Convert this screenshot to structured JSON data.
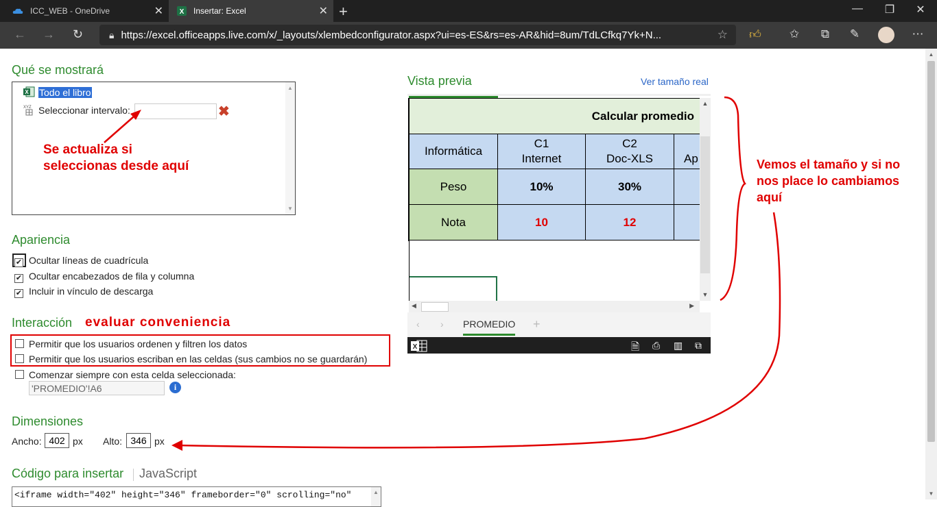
{
  "browser": {
    "tabs": [
      {
        "title": "ICC_WEB - OneDrive"
      },
      {
        "title": "Insertar: Excel"
      }
    ],
    "url": "https://excel.officeapps.live.com/x/_layouts/xlembedconfigurator.aspx?ui=es-ES&rs=es-AR&hid=8um/TdLCfkq7Yk+N..."
  },
  "show": {
    "title": "Qué se mostrará",
    "whole_book": "Todo el libro",
    "select_range": "Seleccionar intervalo:",
    "range_value": ""
  },
  "appearance": {
    "title": "Apariencia",
    "options": [
      {
        "label": "Ocultar líneas de cuadrícula",
        "checked": true
      },
      {
        "label": "Ocultar encabezados de fila y columna",
        "checked": true
      },
      {
        "label": "Incluir in vínculo de descarga",
        "checked": true
      }
    ]
  },
  "interaction": {
    "title": "Interacción",
    "options": [
      {
        "label": "Permitir que los usuarios ordenen y filtren los datos",
        "checked": false
      },
      {
        "label": "Permitir que los usuarios escriban en las celdas (sus cambios no se guardarán)",
        "checked": false
      },
      {
        "label": "Comenzar siempre con esta celda seleccionada:",
        "checked": false
      }
    ],
    "start_cell": "'PROMEDIO'!A6"
  },
  "dimensions": {
    "title": "Dimensiones",
    "width_label": "Ancho:",
    "width": "402",
    "height_label": "Alto:",
    "height": "346",
    "unit": "px"
  },
  "code": {
    "title": "Código para insertar",
    "alt": "JavaScript",
    "snippet": "<iframe width=\"402\" height=\"346\" frameborder=\"0\" scrolling=\"no\""
  },
  "preview": {
    "title": "Vista previa",
    "full_size_link": "Ver tamaño real",
    "sheet_title": "Calcular promedio",
    "header_row": [
      "Informática",
      "C1\nInternet",
      "C2\nDoc-XLS",
      "Ap"
    ],
    "rows": [
      [
        "Peso",
        "10%",
        "30%",
        ""
      ],
      [
        "Nota",
        "10",
        "12",
        ""
      ]
    ],
    "sheet_tab": "PROMEDIO"
  },
  "annotations": {
    "select_here": "Se actualiza si\nseleccionas desde aquí",
    "evaluate": "evaluar conveniencia",
    "size_note": "Vemos el tamaño y si no\nnos place lo cambiamos\naquí"
  },
  "colors": {
    "accent_green": "#2e8b2e",
    "annotation_red": "#e00000",
    "cell_blue": "#c5d9f1",
    "cell_green": "#c4deb1"
  }
}
